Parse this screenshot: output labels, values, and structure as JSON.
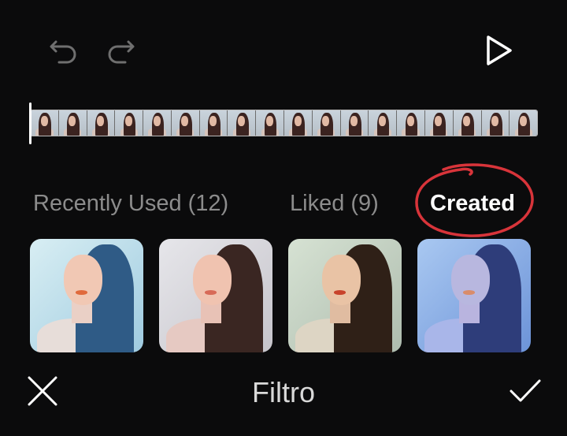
{
  "tabs": [
    {
      "label": "Recently Used (12)",
      "active": false
    },
    {
      "label": "Liked (9)",
      "active": false
    },
    {
      "label": "Created",
      "active": true
    }
  ],
  "bottom_bar": {
    "title": "Filtro"
  },
  "icons": {
    "undo": "undo-icon",
    "redo": "redo-icon",
    "play": "play-icon",
    "close": "close-icon",
    "confirm": "check-icon"
  },
  "annotation_color": "#d8343a",
  "filters": [
    {
      "name": "cool-blue",
      "bg": "#bfe0ea",
      "hair": "#2f5b86",
      "face": "#f1c8b4",
      "body": "#e7ddd9",
      "lips": "#e06a3c"
    },
    {
      "name": "soft-pink",
      "bg": "#dcdbe0",
      "hair": "#3a2622",
      "face": "#f0c3b0",
      "body": "#e6c9c2",
      "lips": "#d76a57"
    },
    {
      "name": "warm-vintage",
      "bg": "#c7d3c2",
      "hair": "#2f2017",
      "face": "#e9c3a5",
      "body": "#ddd5c4",
      "lips": "#c8432c"
    },
    {
      "name": "blue-tone",
      "bg": "#8ab2e8",
      "hair": "#2e3d7a",
      "face": "#b8b7df",
      "body": "#a9b6e9",
      "lips": "#d98c6b"
    }
  ]
}
